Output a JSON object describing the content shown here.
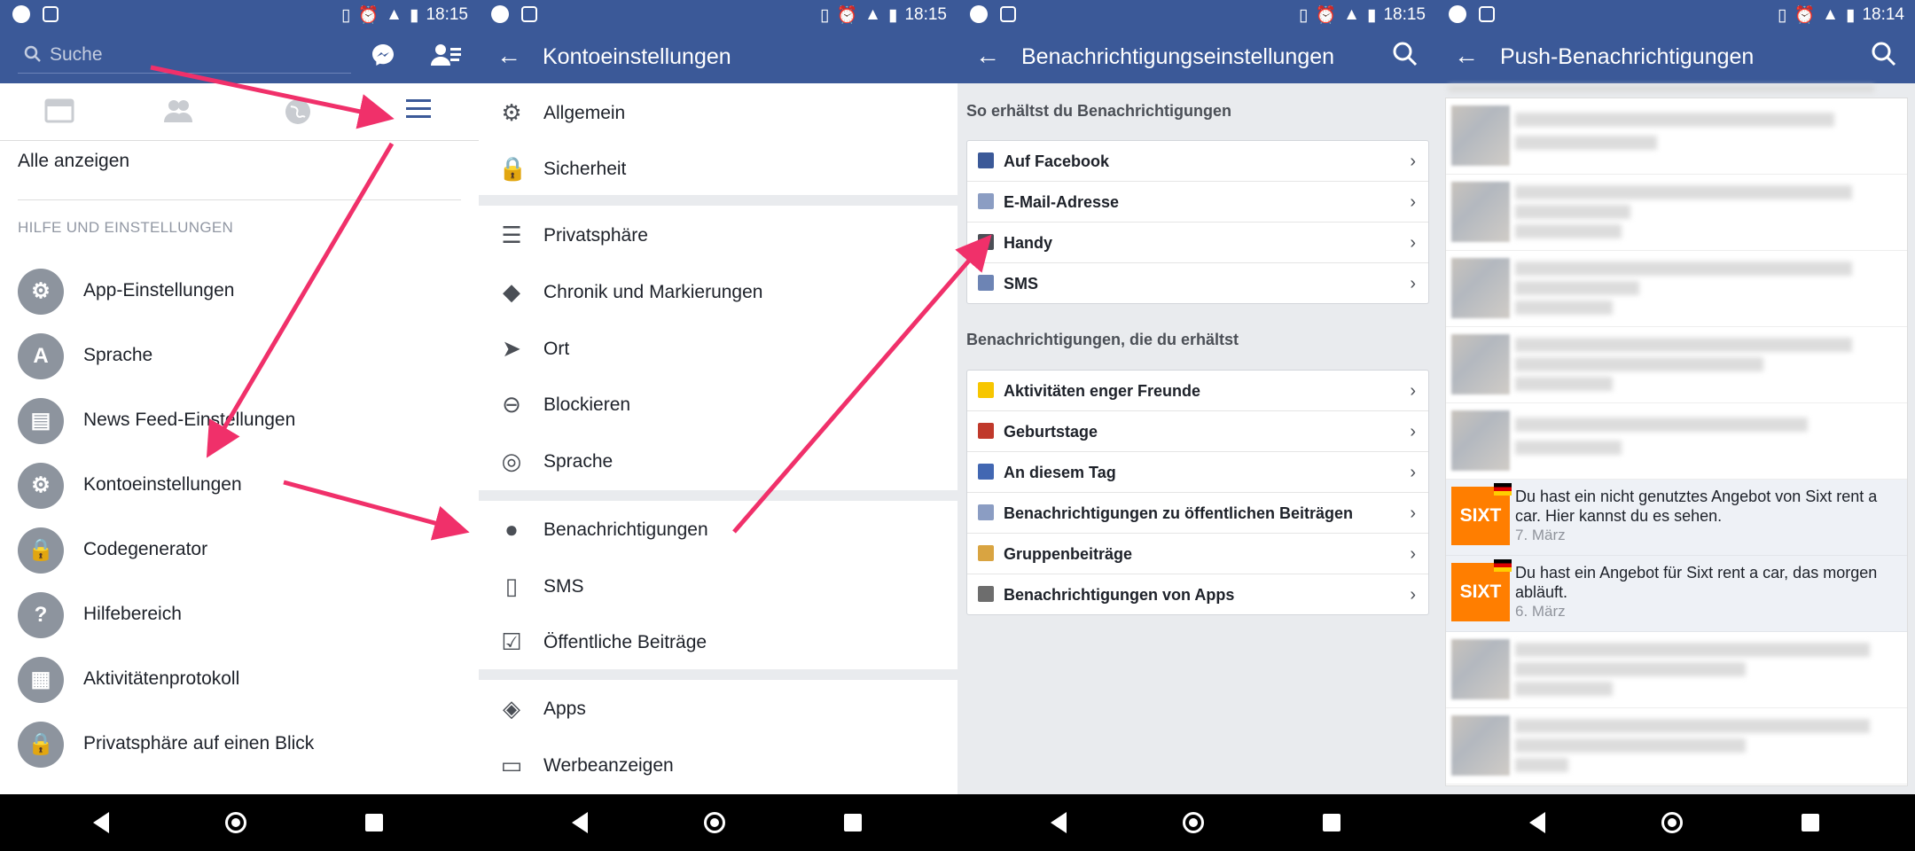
{
  "status": {
    "p1_time": "18:15",
    "p2_time": "18:15",
    "p3_time": "18:15",
    "p4_time": "18:14"
  },
  "panel1": {
    "search_placeholder": "Suche",
    "see_all": "Alle anzeigen",
    "section_header": "HILFE UND EINSTELLUNGEN",
    "items": [
      {
        "label": "App-Einstellungen",
        "icon": "gear-icon",
        "glyph": "⚙"
      },
      {
        "label": "Sprache",
        "icon": "language-icon",
        "glyph": "A"
      },
      {
        "label": "News Feed-Einstellungen",
        "icon": "news-feed-icon",
        "glyph": "▤"
      },
      {
        "label": "Kontoeinstellungen",
        "icon": "account-settings-icon",
        "glyph": "⚙"
      },
      {
        "label": "Codegenerator",
        "icon": "code-generator-icon",
        "glyph": "🔒"
      },
      {
        "label": "Hilfebereich",
        "icon": "help-icon",
        "glyph": "?"
      },
      {
        "label": "Aktivitätenprotokoll",
        "icon": "activity-log-icon",
        "glyph": "▦"
      },
      {
        "label": "Privatsphäre auf einen Blick",
        "icon": "privacy-lock-icon",
        "glyph": "🔒"
      }
    ]
  },
  "panel2": {
    "title": "Kontoeinstellungen",
    "items": [
      {
        "label": "Allgemein",
        "icon": "gear-icon",
        "glyph": "⚙"
      },
      {
        "label": "Sicherheit",
        "icon": "lock-icon",
        "glyph": "🔒"
      },
      {
        "label": "Privatsphäre",
        "icon": "privacy-icon",
        "glyph": "☰"
      },
      {
        "label": "Chronik und Markierungen",
        "icon": "tag-icon",
        "glyph": "◆"
      },
      {
        "label": "Ort",
        "icon": "location-arrow-icon",
        "glyph": "➤"
      },
      {
        "label": "Blockieren",
        "icon": "block-icon",
        "glyph": "⊖"
      },
      {
        "label": "Sprache",
        "icon": "globe-icon",
        "glyph": "◎"
      },
      {
        "label": "Benachrichtigungen",
        "icon": "globe-notifications-icon",
        "glyph": "●"
      },
      {
        "label": "SMS",
        "icon": "phone-icon",
        "glyph": "▯"
      },
      {
        "label": "Öffentliche Beiträge",
        "icon": "public-posts-icon",
        "glyph": "☑"
      },
      {
        "label": "Apps",
        "icon": "apps-cube-icon",
        "glyph": "◈"
      },
      {
        "label": "Werbeanzeigen",
        "icon": "ads-icon",
        "glyph": "▭"
      }
    ]
  },
  "panel3": {
    "title": "Benachrichtigungseinstellungen",
    "header1": "So erhältst du Benachrichtigungen",
    "group1": [
      {
        "label": "Auf Facebook",
        "icon": "facebook-icon",
        "color": "#3b5998"
      },
      {
        "label": "E-Mail-Adresse",
        "icon": "mail-icon",
        "color": "#8b9dc3"
      },
      {
        "label": "Handy",
        "icon": "mobile-phone-icon",
        "color": "#4b4f56"
      },
      {
        "label": "SMS",
        "icon": "sms-phone-icon",
        "color": "#6d84b4"
      }
    ],
    "header2": "Benachrichtigungen, die du erhältst",
    "group2": [
      {
        "label": "Aktivitäten enger Freunde",
        "icon": "star-icon",
        "color": "#f7c600"
      },
      {
        "label": "Geburtstage",
        "icon": "gift-icon",
        "color": "#c0392b"
      },
      {
        "label": "An diesem Tag",
        "icon": "clock-icon",
        "color": "#4267b2"
      },
      {
        "label": "Benachrichtigungen zu öffentlichen Beiträgen",
        "icon": "public-post-icon",
        "color": "#8b9dc3"
      },
      {
        "label": "Gruppenbeiträge",
        "icon": "groups-icon",
        "color": "#d9a441"
      },
      {
        "label": "Benachrichtigungen von Apps",
        "icon": "apps-icon",
        "color": "#6d6d6d"
      }
    ]
  },
  "panel4": {
    "title": "Push-Benachrichtigungen",
    "sixt1_text": "Du hast ein nicht genutztes Angebot von Sixt rent a car. Hier kannst du es sehen.",
    "sixt1_date": "7. März",
    "sixt2_text": "Du hast ein Angebot für Sixt rent a car, das morgen abläuft.",
    "sixt2_date": "6. März",
    "sixt_logo": "SIXT"
  }
}
